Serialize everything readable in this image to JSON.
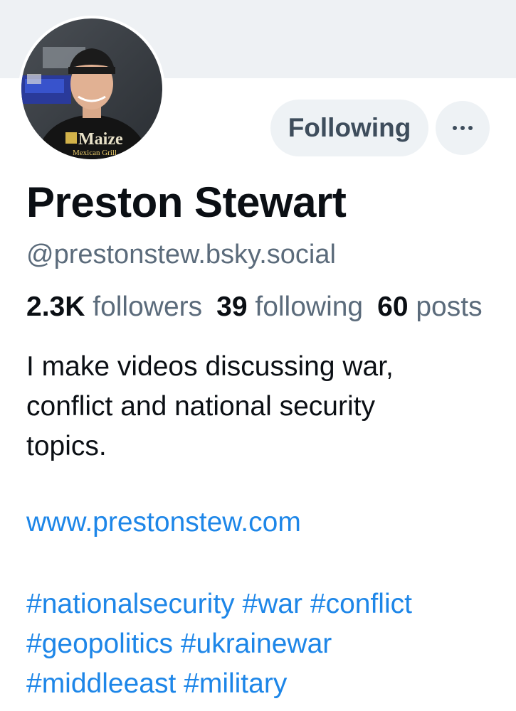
{
  "profile": {
    "display_name": "Preston Stewart",
    "handle": "@prestonstew.bsky.social",
    "stats": {
      "followers_count": "2.3K",
      "followers_label": "followers",
      "following_count": "39",
      "following_label": "following",
      "posts_count": "60",
      "posts_label": "posts"
    },
    "bio_lines": [
      "I make videos discussing war,",
      "conflict and national security",
      "topics."
    ],
    "website": "www.prestonstew.com",
    "hashtags": [
      "#nationalsecurity",
      "#war",
      "#conflict",
      "#geopolitics",
      "#ukrainewar",
      "#middleeast",
      "#military"
    ],
    "avatar_shirt_text": "Maize",
    "avatar_shirt_subtext": "Mexican Grill"
  },
  "actions": {
    "following_label": "Following",
    "more_icon": "ellipsis-icon"
  },
  "colors": {
    "banner": "#eef1f4",
    "link": "#1d86e8",
    "muted_text": "#5b6b7b",
    "button_bg": "#eef2f5"
  }
}
